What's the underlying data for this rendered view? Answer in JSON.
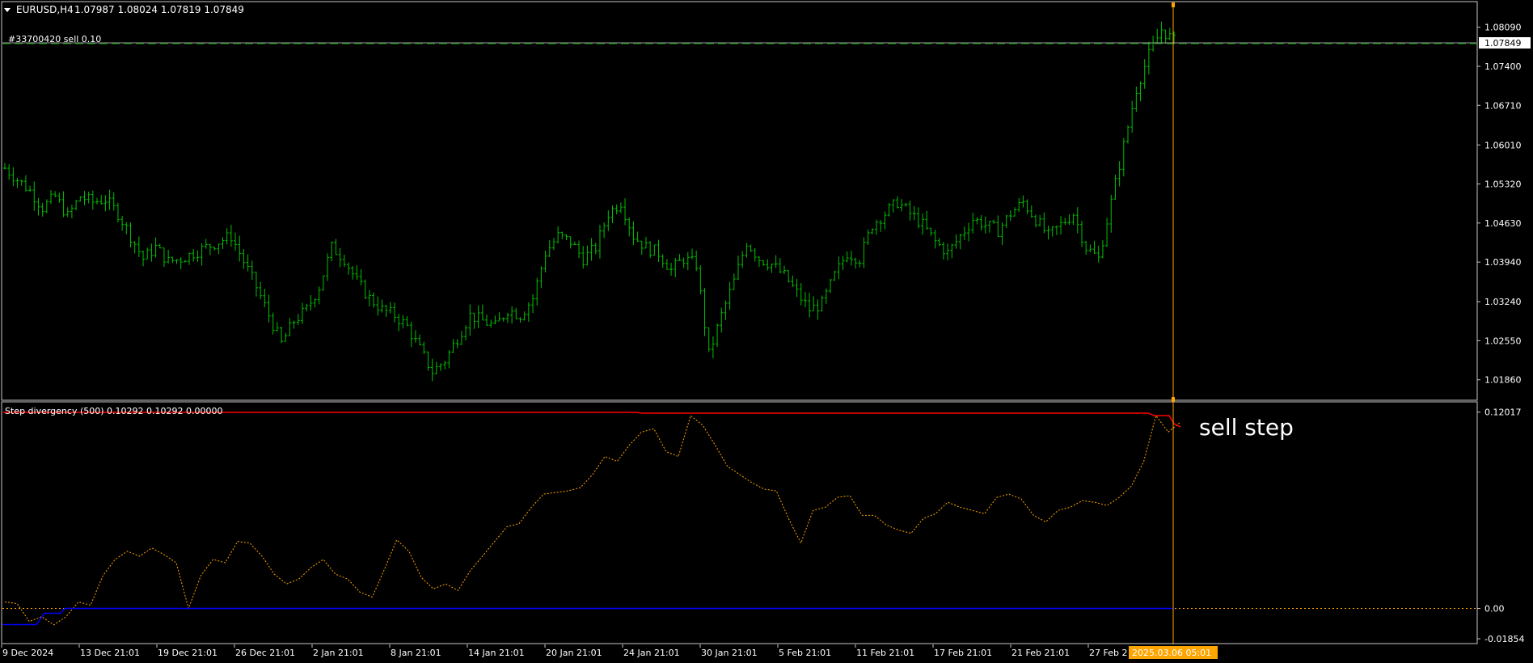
{
  "chart_header": {
    "symbol_label": "EURUSD,H4",
    "ohlc": "1.07987 1.08024 1.07819 1.07849"
  },
  "order_line_label": "#33700420 sell 0.10",
  "current_price_label": "1.07849",
  "indicator_label": "Step divergency (500) 0.10292 0.10292 0.00000",
  "annotation": "sell step",
  "time_cursor_label": "2025.03.06 05:01",
  "colors": {
    "background": "#000000",
    "bull_bar": "#00c000",
    "order_line": "#00a000",
    "cursor": "#ffa500",
    "step_red": "#ff0000",
    "step_blue": "#0000ff",
    "osc_dotted": "#ffa500",
    "text": "#ffffff"
  },
  "chart_data": [
    {
      "type": "bar",
      "name": "EURUSD,H4",
      "ylim": [
        1.0157,
        1.085
      ],
      "y_ticks": [
        "1.08090",
        "1.07400",
        "1.06710",
        "1.06010",
        "1.05320",
        "1.04630",
        "1.03940",
        "1.03240",
        "1.02550",
        "1.01860"
      ],
      "x_ticks": [
        "9 Dec 2024",
        "13 Dec 21:01",
        "19 Dec 21:01",
        "26 Dec 21:01",
        "2 Jan 21:01",
        "8 Jan 21:01",
        "14 Jan 21:01",
        "20 Jan 21:01",
        "24 Jan 21:01",
        "30 Jan 21:01",
        "5 Feb 21:01",
        "11 Feb 21:01",
        "17 Feb 21:01",
        "21 Feb 21:01",
        "27 Feb 2"
      ],
      "close_values": [
        1.056,
        1.054,
        1.052,
        1.049,
        1.051,
        1.0475,
        1.051,
        1.05,
        1.0505,
        1.048,
        1.044,
        1.04,
        1.042,
        1.0395,
        1.04,
        1.041,
        1.042,
        1.043,
        1.044,
        1.0395,
        1.035,
        1.03,
        1.025,
        1.029,
        1.031,
        1.035,
        1.042,
        1.04,
        1.036,
        1.033,
        1.031,
        1.03,
        1.028,
        1.024,
        1.02,
        1.022,
        1.026,
        1.03,
        1.029,
        1.028,
        1.031,
        1.03,
        1.033,
        1.041,
        1.044,
        1.043,
        1.04,
        1.042,
        1.048,
        1.05,
        1.044,
        1.042,
        1.041,
        1.038,
        1.04,
        1.039,
        1.023,
        1.03,
        1.036,
        1.043,
        1.04,
        1.039,
        1.037,
        1.034,
        1.031,
        1.032,
        1.037,
        1.041,
        1.04,
        1.046,
        1.048,
        1.05,
        1.048,
        1.046,
        1.043,
        1.041,
        1.044,
        1.047,
        1.046,
        1.045,
        1.048,
        1.05,
        1.047,
        1.044,
        1.046,
        1.048,
        1.042,
        1.04,
        1.05,
        1.06,
        1.07,
        1.076,
        1.0805,
        1.0785
      ],
      "value_unit": "price"
    },
    {
      "type": "line",
      "name": "Step divergency (500)",
      "ylim": [
        -0.021,
        0.1225
      ],
      "y_ticks": [
        "0.12017",
        "0.00",
        "-0.01854"
      ],
      "series_values": {
        "dotted": [
          0.004,
          0.003,
          -0.008,
          -0.005,
          -0.01,
          -0.005,
          0.004,
          0.002,
          0.02,
          0.03,
          0.035,
          0.032,
          0.037,
          0.033,
          0.028,
          0.0,
          0.02,
          0.03,
          0.028,
          0.041,
          0.04,
          0.032,
          0.021,
          0.015,
          0.018,
          0.025,
          0.03,
          0.021,
          0.018,
          0.01,
          0.007,
          0.024,
          0.042,
          0.035,
          0.019,
          0.012,
          0.015,
          0.011,
          0.023,
          0.032,
          0.041,
          0.05,
          0.052,
          0.062,
          0.07,
          0.071,
          0.072,
          0.074,
          0.082,
          0.093,
          0.09,
          0.1,
          0.108,
          0.11,
          0.096,
          0.093,
          0.118,
          0.112,
          0.1,
          0.087,
          0.082,
          0.077,
          0.073,
          0.072,
          0.055,
          0.04,
          0.06,
          0.062,
          0.068,
          0.069,
          0.057,
          0.057,
          0.051,
          0.048,
          0.046,
          0.055,
          0.058,
          0.065,
          0.062,
          0.06,
          0.058,
          0.068,
          0.07,
          0.067,
          0.057,
          0.053,
          0.06,
          0.062,
          0.066,
          0.065,
          0.063,
          0.068,
          0.075,
          0.09,
          0.118,
          0.108,
          0.114
        ]
      },
      "step_levels": {
        "red": 0.12,
        "blue": 0.0
      }
    }
  ]
}
